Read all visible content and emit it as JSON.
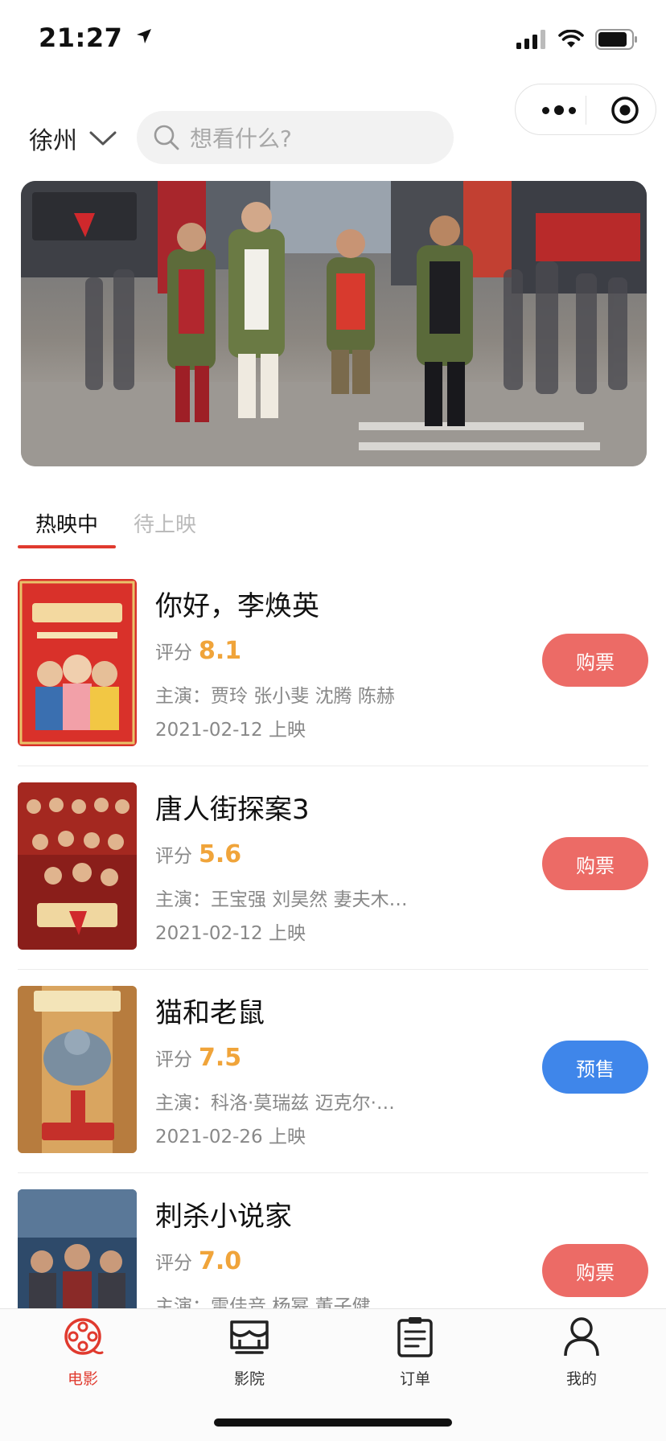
{
  "status_bar": {
    "time": "21:27"
  },
  "header": {
    "city": "徐州",
    "search_placeholder": "想看什么?"
  },
  "tabs": [
    {
      "label": "热映中",
      "active": true
    },
    {
      "label": "待上映",
      "active": false
    }
  ],
  "movies": [
    {
      "title": "你好，李焕英",
      "score_label": "评分",
      "score": "8.1",
      "cast": "主演：贾玲 张小斐 沈腾 陈赫",
      "date": "2021-02-12 上映",
      "action": "购票",
      "action_type": "buy"
    },
    {
      "title": "唐人街探案3",
      "score_label": "评分",
      "score": "5.6",
      "cast": "主演：王宝强 刘昊然 妻夫木…",
      "date": "2021-02-12 上映",
      "action": "购票",
      "action_type": "buy"
    },
    {
      "title": "猫和老鼠",
      "score_label": "评分",
      "score": "7.5",
      "cast": "主演：科洛·莫瑞兹 迈克尔·…",
      "date": "2021-02-26 上映",
      "action": "预售",
      "action_type": "presale"
    },
    {
      "title": "刺杀小说家",
      "score_label": "评分",
      "score": "7.0",
      "cast": "主演：雷佳音 杨幂 董子健 …",
      "date": "",
      "action": "购票",
      "action_type": "buy"
    }
  ],
  "bottom_nav": [
    {
      "label": "电影",
      "icon": "film-reel-icon",
      "active": true
    },
    {
      "label": "影院",
      "icon": "cinema-icon",
      "active": false
    },
    {
      "label": "订单",
      "icon": "order-clipboard-icon",
      "active": false
    },
    {
      "label": "我的",
      "icon": "user-icon",
      "active": false
    }
  ],
  "colors": {
    "accent": "#e03a2e",
    "buy_button": "#ec6b66",
    "presale_button": "#3f86ea",
    "score": "#f0a43a"
  }
}
